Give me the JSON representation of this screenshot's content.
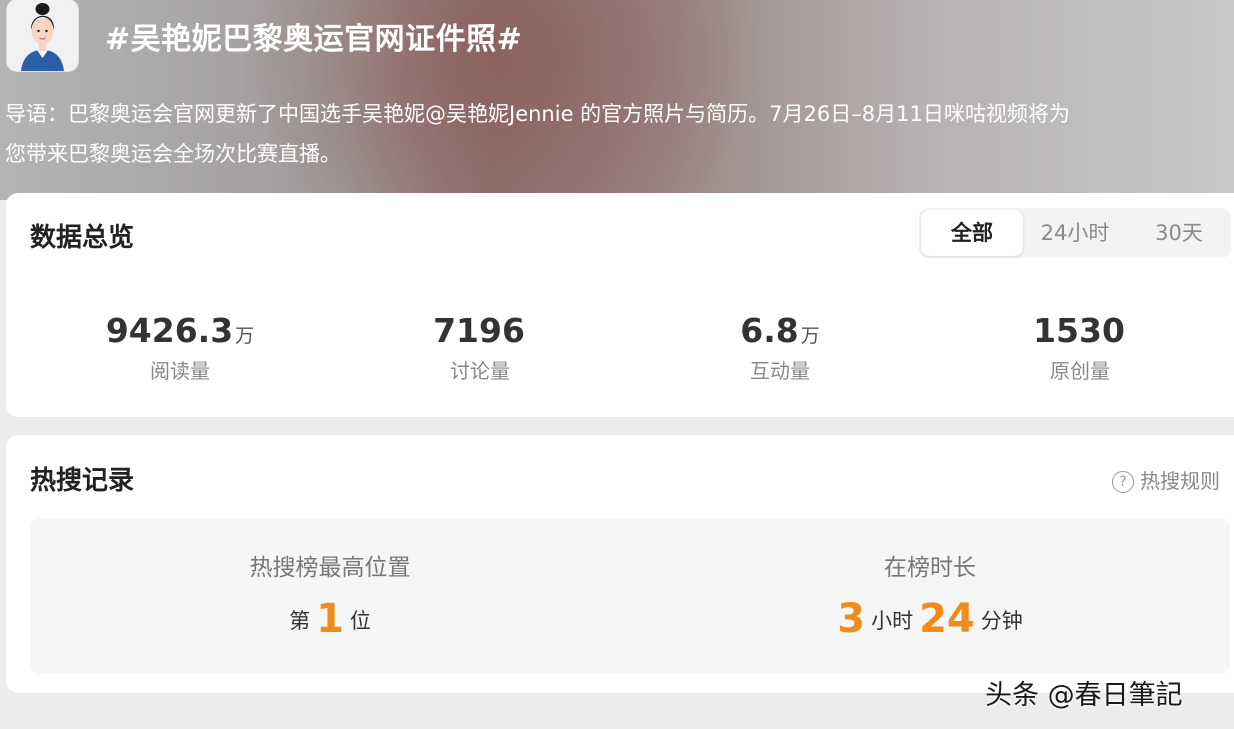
{
  "header": {
    "topic_title": "#吴艳妮巴黎奥运官网证件照#",
    "intro_line1": "导语：巴黎奥运会官网更新了中国选手吴艳妮@吴艳妮Jennie 的官方照片与简历。7月26日–8月11日咪咕视频将为",
    "intro_line2": "您带来巴黎奥运会全场次比赛直播。"
  },
  "overview": {
    "heading": "数据总览",
    "tabs": [
      {
        "label": "全部",
        "active": true
      },
      {
        "label": "24小时",
        "active": false
      },
      {
        "label": "30天",
        "active": false
      }
    ],
    "stats": [
      {
        "value": "9426.3",
        "unit": "万",
        "label": "阅读量"
      },
      {
        "value": "7196",
        "unit": "",
        "label": "讨论量"
      },
      {
        "value": "6.8",
        "unit": "万",
        "label": "互动量"
      },
      {
        "value": "1530",
        "unit": "",
        "label": "原创量"
      }
    ]
  },
  "hot_search": {
    "heading": "热搜记录",
    "rules_label": "热搜规则",
    "help_glyph": "?",
    "highest_position": {
      "label": "热搜榜最高位置",
      "prefix": "第",
      "value": "1",
      "suffix": "位"
    },
    "duration": {
      "label": "在榜时长",
      "hours": "3",
      "hours_unit": "小时",
      "minutes": "24",
      "minutes_unit": "分钟"
    }
  },
  "watermark": "头条 @春日筆記",
  "colors": {
    "accent_orange": "#f08c1a",
    "card_bg": "#ffffff",
    "panel_bg": "#f6f6f6"
  }
}
